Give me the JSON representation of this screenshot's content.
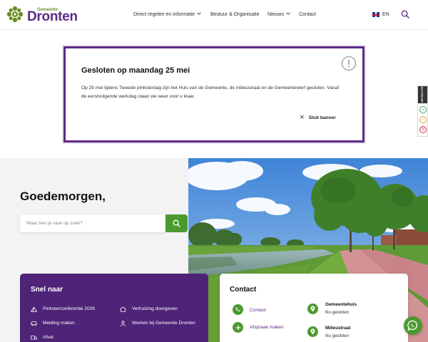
{
  "header": {
    "logo_small": "Gemeente",
    "logo_word": "Dronten",
    "nav": [
      {
        "label": "Direct regelen en informatie",
        "has_dropdown": true
      },
      {
        "label": "Bestuur & Organisatie",
        "has_dropdown": false
      },
      {
        "label": "Nieuws",
        "has_dropdown": true
      },
      {
        "label": "Contact",
        "has_dropdown": false
      }
    ],
    "language": "EN"
  },
  "banner": {
    "title": "Gesloten op maandag 25 mei",
    "text": "Op 25 mei tijdens Tweede pinksterdag zijn het Huis van de Gemeente, de milieustraat en de Gemeentewerf gesloten. Vanaf de eerstvolgende werkdag staan we weer voor u klaar.",
    "close_label": "Sluit banner"
  },
  "feedback": {
    "tab_label": "UW REACTIE"
  },
  "hero": {
    "greeting": "Goedemorgen,",
    "search_placeholder": "Waar ben je naar op zoek?"
  },
  "snel_naar": {
    "title": "Snel naar",
    "items": [
      {
        "label": "Pinksterconferentie 2026",
        "icon": "tent-icon"
      },
      {
        "label": "Verhuizing doorgeven",
        "icon": "house-icon"
      },
      {
        "label": "Melding maken",
        "icon": "car-icon"
      },
      {
        "label": "Werken bij Gemeente Dronten",
        "icon": "person-icon"
      },
      {
        "label": "Afval",
        "icon": "truck-icon"
      }
    ]
  },
  "contact": {
    "title": "Contact",
    "links": [
      {
        "label": "Contact",
        "icon": "phone-icon"
      },
      {
        "label": "Afspraak maken",
        "icon": "plus-icon"
      }
    ],
    "places": [
      {
        "name": "Gemeentehuis",
        "status": "Nu gesloten"
      },
      {
        "name": "Milieustraat",
        "status": "Nu gesloten"
      }
    ]
  },
  "colors": {
    "brand_purple": "#5b2a86",
    "brand_green": "#4b9a2f",
    "panel_purple": "#4e2378"
  }
}
